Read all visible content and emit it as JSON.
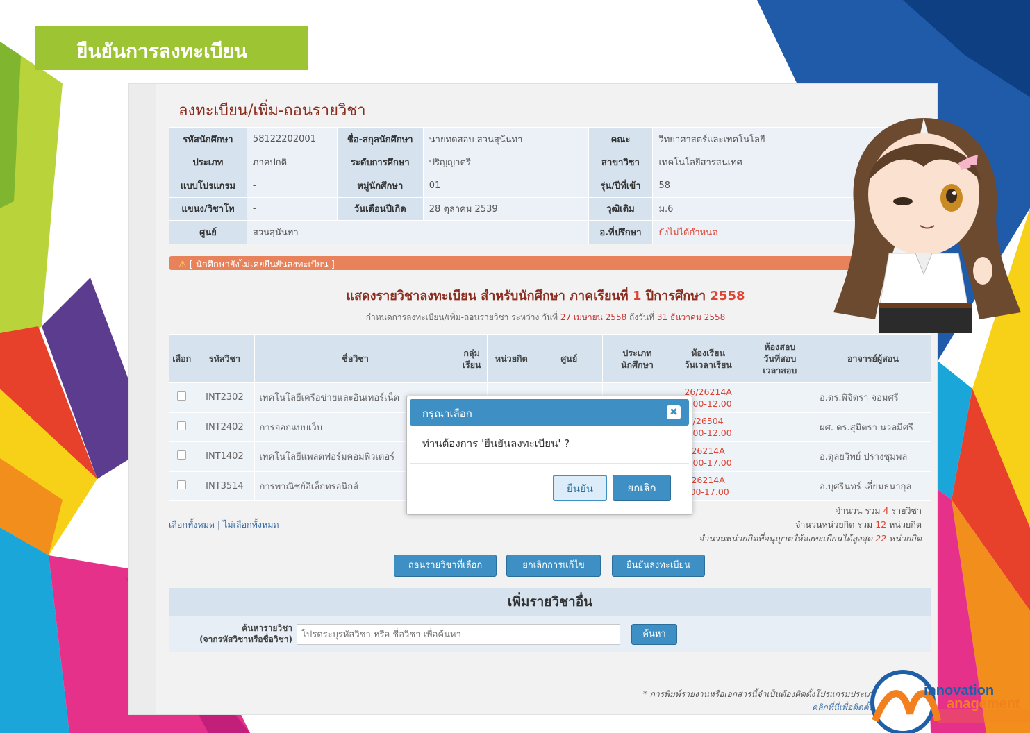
{
  "slide": {
    "title": "ยืนยันการลงทะเบียน"
  },
  "page": {
    "heading": "ลงทะเบียน/เพิ่ม-ถอนรายวิชา"
  },
  "student_info": {
    "rows": [
      [
        {
          "label": "รหัสนักศึกษา",
          "value": "58122202001"
        },
        {
          "label": "ชื่อ-สกุลนักศึกษา",
          "value": "นายทดสอบ สวนสุนันทา"
        },
        {
          "label": "คณะ",
          "value": "วิทยาศาสตร์และเทคโนโลยี"
        }
      ],
      [
        {
          "label": "ประเภท",
          "value": "ภาคปกติ"
        },
        {
          "label": "ระดับการศึกษา",
          "value": "ปริญญาตรี"
        },
        {
          "label": "สาขาวิชา",
          "value": "เทคโนโลยีสารสนเทศ"
        }
      ],
      [
        {
          "label": "แบบโปรแกรม",
          "value": "-"
        },
        {
          "label": "หมู่นักศึกษา",
          "value": "01"
        },
        {
          "label": "รุ่น/ปีที่เข้า",
          "value": "58"
        }
      ],
      [
        {
          "label": "แขนง/วิชาโท",
          "value": "-"
        },
        {
          "label": "วันเดือนปีเกิด",
          "value": "28 ตุลาคม 2539"
        },
        {
          "label": "วุฒิเดิม",
          "value": "ม.6"
        }
      ],
      [
        {
          "label": "ศูนย์",
          "value": "สวนสุนันทา"
        },
        {
          "label": "",
          "value": ""
        },
        {
          "label": "อ.ที่ปรึกษา",
          "value": "ยังไม่ได้กำหนด"
        }
      ]
    ]
  },
  "warning": {
    "icon": "warning-icon",
    "text": "[ นักศึกษายังไม่เคยยืนยันลงทะเบียน ]"
  },
  "schedule": {
    "title_prefix": "แสดงรายวิชาลงทะเบียน สำหรับนักศึกษา ภาคเรียนที่",
    "semester": "1",
    "year_label": "ปีการศึกษา",
    "year": "2558",
    "sub_prefix": "กำหนดการลงทะเบียน/เพิ่ม-ถอนรายวิชา ระหว่าง วันที่",
    "start_date": "27 เมษายน 2558",
    "to_label": "ถึงวันที่",
    "end_date": "31 ธันวาคม 2558"
  },
  "course_table": {
    "headers": {
      "select": "เลือก",
      "code": "รหัสวิชา",
      "name": "ชื่อวิชา",
      "group_1": "กลุ่ม",
      "group_2": "เรียน",
      "credits": "หน่วยกิต",
      "center": "ศูนย์",
      "type_1": "ประเภท",
      "type_2": "นักศึกษา",
      "room_1": "ห้องเรียน",
      "room_2": "วันเวลาเรียน",
      "exam_1": "ห้องสอบ",
      "exam_2": "วันที่สอบ",
      "exam_3": "เวลาสอบ",
      "teacher": "อาจารย์ผู้สอน"
    },
    "rows": [
      {
        "code": "INT2302",
        "name": "เทคโนโลยีเครือข่ายและอินเทอร์เน็ต",
        "room_1": "26/26214A",
        "room_2": "3.00-12.00",
        "teacher": "อ.ดร.พิจิตรา จอมศรี"
      },
      {
        "code": "INT2402",
        "name": "การออกแบบเว็บ",
        "room_1": "/26504",
        "room_2": "8.00-12.00",
        "teacher": "ผศ. ดร.สุมิตรา นวลมีศรี"
      },
      {
        "code": "INT1402",
        "name": "เทคโนโลยีแพลตฟอร์มคอมพิวเตอร์",
        "room_1": "26214A",
        "room_2": "3.00-17.00",
        "teacher": "อ.ดุลยวิทย์ ปรางชุมพล"
      },
      {
        "code": "INT3514",
        "name": "การพาณิชย์อิเล็กทรอนิกส์",
        "room_1": "26214A",
        "room_2": ".00-17.00",
        "teacher": "อ.บุศรินทร์ เอี่ยมธนากุล"
      }
    ]
  },
  "select_links": {
    "all": "เลือกทั้งหมด",
    "sep": " | ",
    "none": "ไม่เลือกทั้งหมด"
  },
  "totals": {
    "count_label": "จำนวน รวม",
    "count": "4",
    "count_unit": "รายวิชา",
    "credit_label": "จำนวนหน่วยกิต รวม",
    "credits": "12",
    "credit_unit": "หน่วยกิต",
    "max_label": "จำนวนหน่วยกิตที่อนุญาตให้ลงทะเบียนได้สูงสุด",
    "max": "22",
    "max_unit": "หน่วยกิต"
  },
  "actions": {
    "drop": "ถอนรายวิชาที่เลือก",
    "cancel_edit": "ยกเลิกการแก้ไข",
    "confirm_register": "ยืนยันลงทะเบียน"
  },
  "add_section": {
    "title": "เพิ่มรายวิชาอื่น",
    "search_label_1": "ค้นหารายวิชา",
    "search_label_2": "(จากรหัสวิชาหรือชื่อวิชา)",
    "placeholder": "โปรดระบุรหัสวิชา หรือ ชื่อวิชา เพื่อค้นหา",
    "search_button": "ค้นหา"
  },
  "footnote": {
    "line1": "* การพิมพ์รายงานหรือเอกสารนี้จำเป็นต้องติดตั้งโปรแกรมประเภท PDF",
    "line2": "คลิกที่นี่เพื่อติดตั้ง Adob"
  },
  "modal": {
    "title": "กรุณาเลือก",
    "message": "ท่านต้องการ 'ยืนยันลงทะเบียน' ?",
    "confirm": "ยืนยัน",
    "cancel": "ยกเลิก",
    "close_icon": "close-icon"
  },
  "logo": {
    "line1": "innovation",
    "line2": "anagement"
  },
  "colors": {
    "accent_green": "#9dc432",
    "primary_blue": "#3d8fc4",
    "warning_orange": "#e8825a",
    "heading_red": "#8a2c1e"
  }
}
